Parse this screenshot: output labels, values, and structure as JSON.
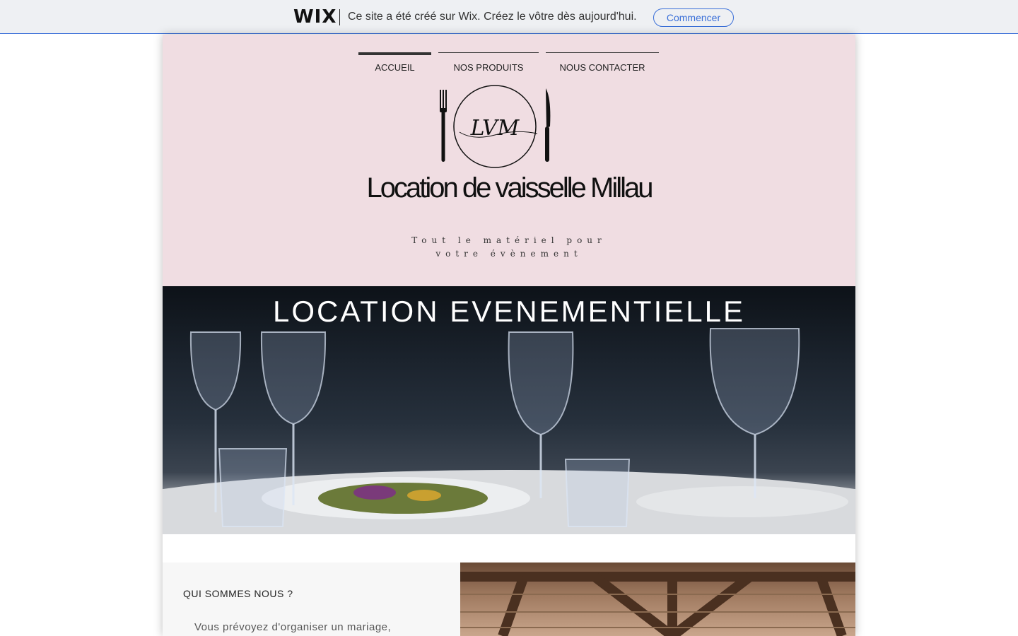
{
  "wix_banner": {
    "logo": "WIX",
    "message": "Ce site a été créé sur Wix. Créez le vôtre dès aujourd'hui.",
    "cta": "Commencer",
    "accent": "#3a6fd8"
  },
  "nav": {
    "items": [
      {
        "label": "ACCUEIL",
        "active": true
      },
      {
        "label": "NOS PRODUITS",
        "active": false
      },
      {
        "label": "NOUS CONTACTER",
        "active": false
      }
    ]
  },
  "header": {
    "logo_text": "LVM",
    "title": "Location de vaisselle Millau",
    "tagline_line1": "Tout le matériel pour",
    "tagline_line2": "votre évènement",
    "background": "#f0dde2"
  },
  "hero": {
    "title": "LOCATION EVENEMENTIELLE"
  },
  "about": {
    "heading": "QUI SOMMES NOUS ?",
    "text": "Vous prévoyez d'organiser un mariage,"
  }
}
